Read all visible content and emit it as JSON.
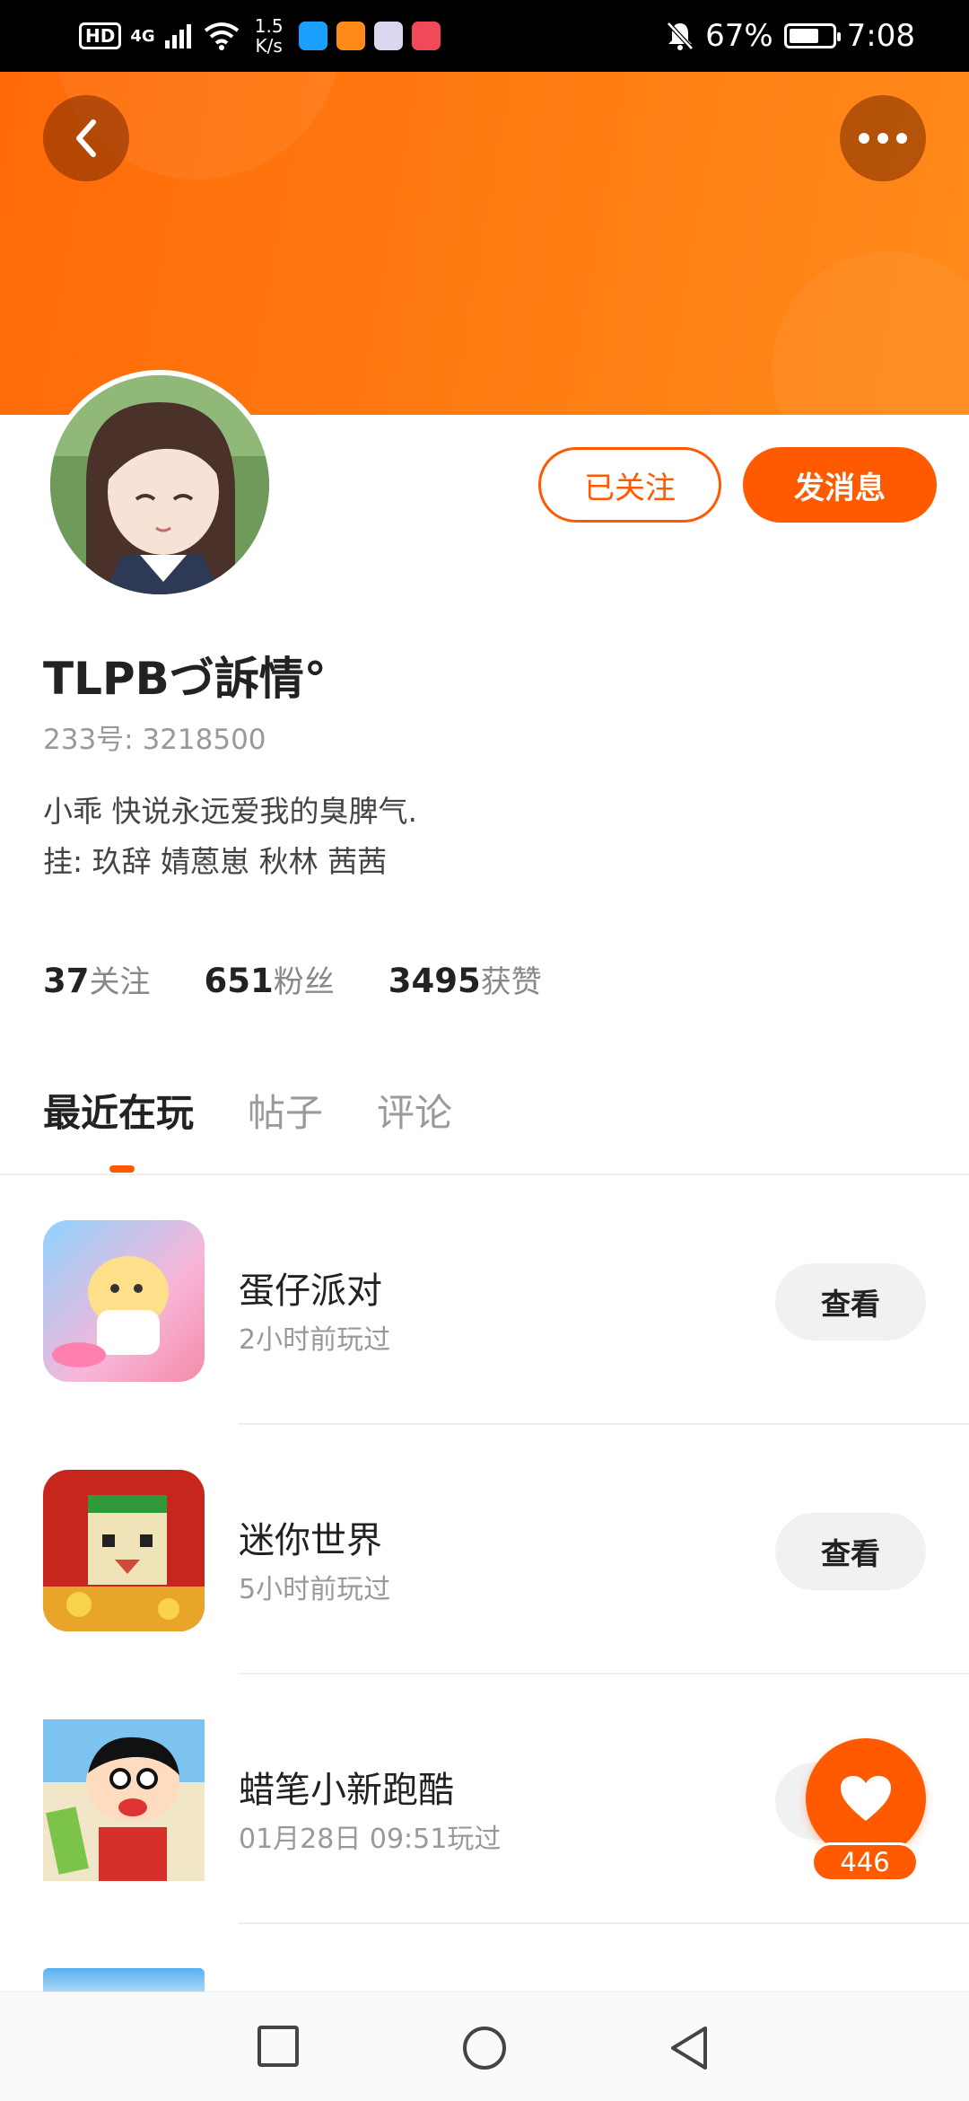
{
  "status_bar": {
    "hd": "HD",
    "network": "4G",
    "speed_value": "1.5",
    "speed_unit": "K/s",
    "battery": "67%",
    "time": "7:08"
  },
  "profile": {
    "username": "TLPBづ訴情°",
    "uid": "233号: 3218500",
    "bio_line1": "小乖 快说永远爱我的臭脾气.",
    "bio_line2": "挂: 玖辞  婧蒽崽 秋林 茜茜",
    "follow_label": "已关注",
    "message_label": "发消息"
  },
  "stats": [
    {
      "num": "37",
      "label": "关注"
    },
    {
      "num": "651",
      "label": "粉丝"
    },
    {
      "num": "3495",
      "label": "获赞"
    }
  ],
  "tabs": [
    {
      "label": "最近在玩",
      "active": true
    },
    {
      "label": "帖子",
      "active": false
    },
    {
      "label": "评论",
      "active": false
    }
  ],
  "games": [
    {
      "name": "蛋仔派对",
      "time": "2小时前玩过",
      "button": "查看"
    },
    {
      "name": "迷你世界",
      "time": "5小时前玩过",
      "button": "查看"
    },
    {
      "name": "蜡笔小新跑酷",
      "time": "01月28日 09:51玩过",
      "button": "查看"
    }
  ],
  "like": {
    "count": "446"
  },
  "colors": {
    "accent": "#ff5a00",
    "banner": "#ff7a10"
  }
}
